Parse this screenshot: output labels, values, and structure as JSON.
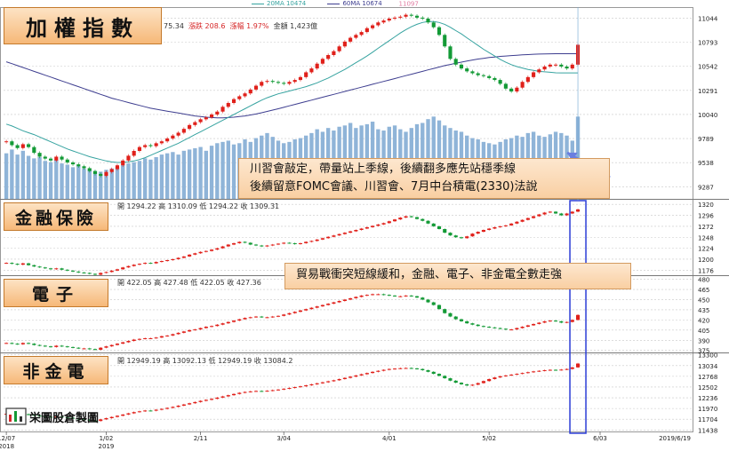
{
  "legend": {
    "ma20": {
      "label": "20MA 10474",
      "color": "#36a3a0"
    },
    "ma60": {
      "label": "60MA 10674",
      "color": "#3d3d8f"
    }
  },
  "panels": [
    {
      "id": "taiex",
      "title": "加權指數",
      "stats_parts": [
        "75.34",
        "漲跌 208.6",
        "漲幅 1.97%",
        "金額 1,423億"
      ]
    },
    {
      "id": "finance",
      "title": "金融保險",
      "stats_parts": [
        "開 1294.22",
        "高 1310.09",
        "低 1294.22",
        "收 1309.31"
      ]
    },
    {
      "id": "electronics",
      "title": "電子",
      "stats_parts": [
        "開 422.05",
        "高 427.48",
        "低 422.05",
        "收 427.36"
      ]
    },
    {
      "id": "nonfin_elec",
      "title": "非金電",
      "stats_parts": [
        "開 12949.19",
        "高 13092.13",
        "低 12949.19",
        "收 13084.2"
      ]
    }
  ],
  "notes": {
    "note1": [
      "川習會敲定，帶量站上季線，後續翻多應先站穩季線",
      "後續留意FOMC會議、川習會、7月中台積電(2330)法說"
    ],
    "note2": [
      "貿易戰衝突短線緩和，金融、電子、非金電全數走強"
    ]
  },
  "logo_text": "栄圖股倉製圖",
  "peak_label": "11097",
  "colors": {
    "up": "#e0201a",
    "down": "#139a36",
    "volume": "#8fb4d8",
    "highlight": "#2b3dd6",
    "arrow": "#6a7fe0",
    "grid": "#c8c8c8"
  },
  "chart_data": [
    {
      "type": "candlestick",
      "id": "taiex",
      "title": "加權指數",
      "yticks": [
        11044,
        10793,
        10542,
        10291,
        10040,
        9789,
        9538,
        9287
      ],
      "ylim": [
        9160,
        11160
      ],
      "close": [
        9760,
        9720,
        9690,
        9730,
        9700,
        9640,
        9600,
        9580,
        9560,
        9600,
        9570,
        9540,
        9520,
        9500,
        9480,
        9450,
        9420,
        9400,
        9440,
        9470,
        9510,
        9560,
        9610,
        9660,
        9700,
        9720,
        9710,
        9740,
        9760,
        9790,
        9820,
        9850,
        9890,
        9930,
        9960,
        9990,
        10010,
        10040,
        10070,
        10120,
        10160,
        10200,
        10230,
        10260,
        10300,
        10340,
        10380,
        10390,
        10380,
        10370,
        10360,
        10380,
        10400,
        10430,
        10480,
        10520,
        10570,
        10620,
        10660,
        10700,
        10750,
        10800,
        10840,
        10870,
        10900,
        10940,
        10970,
        11000,
        11020,
        11040,
        11050,
        11060,
        11080,
        11070,
        11050,
        11040,
        11000,
        10950,
        10870,
        10750,
        10620,
        10560,
        10520,
        10490,
        10470,
        10450,
        10440,
        10420,
        10400,
        10360,
        10310,
        10280,
        10320,
        10380,
        10430,
        10480,
        10510,
        10540,
        10560,
        10560,
        10540,
        10520,
        10560,
        10767
      ],
      "volume_ylim": [
        0,
        1600
      ],
      "volume": [
        720,
        780,
        700,
        760,
        680,
        640,
        660,
        600,
        580,
        620,
        560,
        540,
        500,
        520,
        480,
        470,
        440,
        430,
        460,
        480,
        500,
        540,
        560,
        580,
        600,
        640,
        620,
        660,
        700,
        720,
        740,
        700,
        760,
        780,
        800,
        820,
        760,
        840,
        880,
        900,
        920,
        860,
        880,
        940,
        900,
        960,
        1000,
        1040,
        980,
        920,
        880,
        900,
        940,
        960,
        1000,
        1040,
        1100,
        1060,
        1120,
        1080,
        1140,
        1160,
        1200,
        1120,
        1160,
        1180,
        1220,
        1100,
        1080,
        1140,
        1160,
        1100,
        1060,
        1120,
        1180,
        1200,
        1260,
        1300,
        1240,
        1160,
        1120,
        1080,
        1060,
        1000,
        960,
        940,
        900,
        880,
        860,
        900,
        940,
        960,
        1000,
        980,
        1040,
        1060,
        1000,
        980,
        1020,
        1060,
        1040,
        1000,
        920,
        1300
      ],
      "ma20": [
        9940,
        9920,
        9895,
        9870,
        9850,
        9830,
        9805,
        9780,
        9755,
        9730,
        9705,
        9680,
        9660,
        9640,
        9620,
        9600,
        9585,
        9570,
        9555,
        9545,
        9540,
        9540,
        9545,
        9555,
        9570,
        9590,
        9615,
        9640,
        9665,
        9690,
        9715,
        9740,
        9770,
        9800,
        9830,
        9860,
        9890,
        9920,
        9950,
        9980,
        10010,
        10040,
        10070,
        10100,
        10130,
        10160,
        10190,
        10215,
        10235,
        10255,
        10270,
        10285,
        10300,
        10315,
        10330,
        10350,
        10370,
        10395,
        10420,
        10450,
        10480,
        10510,
        10545,
        10580,
        10615,
        10650,
        10690,
        10730,
        10770,
        10810,
        10850,
        10890,
        10925,
        10955,
        10980,
        11000,
        11010,
        11010,
        11000,
        10980,
        10950,
        10915,
        10880,
        10840,
        10800,
        10760,
        10720,
        10685,
        10650,
        10615,
        10585,
        10560,
        10540,
        10525,
        10510,
        10500,
        10490,
        10485,
        10480,
        10475,
        10474,
        10474,
        10474,
        10474
      ],
      "ma60": [
        10590,
        10570,
        10550,
        10530,
        10510,
        10490,
        10470,
        10450,
        10430,
        10410,
        10390,
        10370,
        10350,
        10330,
        10310,
        10290,
        10270,
        10250,
        10230,
        10210,
        10195,
        10180,
        10165,
        10150,
        10135,
        10120,
        10105,
        10095,
        10085,
        10075,
        10065,
        10055,
        10045,
        10035,
        10025,
        10018,
        10012,
        10008,
        10005,
        10005,
        10008,
        10012,
        10018,
        10025,
        10035,
        10045,
        10058,
        10072,
        10086,
        10100,
        10115,
        10130,
        10145,
        10160,
        10175,
        10190,
        10205,
        10220,
        10235,
        10250,
        10265,
        10280,
        10295,
        10310,
        10325,
        10340,
        10355,
        10370,
        10385,
        10400,
        10415,
        10430,
        10445,
        10460,
        10475,
        10490,
        10505,
        10520,
        10535,
        10550,
        10562,
        10574,
        10586,
        10598,
        10608,
        10618,
        10626,
        10634,
        10640,
        10646,
        10650,
        10654,
        10658,
        10662,
        10665,
        10668,
        10670,
        10672,
        10673,
        10674,
        10674,
        10674,
        10674,
        10674
      ]
    },
    {
      "type": "candlestick",
      "id": "finance",
      "title": "金融保險",
      "yticks": [
        1320,
        1296,
        1272,
        1248,
        1224,
        1200,
        1176
      ],
      "ylim": [
        1165,
        1332
      ],
      "close": [
        1192,
        1190,
        1188,
        1191,
        1187,
        1184,
        1182,
        1180,
        1178,
        1180,
        1177,
        1175,
        1173,
        1171,
        1170,
        1168,
        1166,
        1170,
        1172,
        1175,
        1178,
        1182,
        1185,
        1188,
        1190,
        1192,
        1191,
        1194,
        1196,
        1198,
        1200,
        1203,
        1206,
        1210,
        1213,
        1216,
        1218,
        1221,
        1224,
        1228,
        1232,
        1235,
        1238,
        1236,
        1232,
        1230,
        1228,
        1230,
        1232,
        1234,
        1236,
        1235,
        1233,
        1235,
        1238,
        1240,
        1243,
        1246,
        1249,
        1252,
        1255,
        1258,
        1261,
        1264,
        1267,
        1270,
        1273,
        1276,
        1279,
        1283,
        1287,
        1291,
        1294,
        1292,
        1288,
        1284,
        1278,
        1272,
        1266,
        1258,
        1252,
        1248,
        1246,
        1250,
        1256,
        1260,
        1264,
        1267,
        1270,
        1272,
        1274,
        1278,
        1282,
        1286,
        1290,
        1294,
        1298,
        1302,
        1304,
        1300,
        1296,
        1300,
        1304,
        1309
      ],
      "volume": []
    },
    {
      "type": "candlestick",
      "id": "electronics",
      "title": "電子",
      "yticks": [
        480,
        465,
        450,
        435,
        420,
        405,
        390,
        375
      ],
      "ylim": [
        372,
        486
      ],
      "close": [
        386,
        385,
        384,
        386,
        385,
        383,
        382,
        381,
        380,
        382,
        381,
        380,
        379,
        378,
        378,
        377,
        376,
        379,
        381,
        383,
        385,
        387,
        389,
        391,
        392,
        393,
        393,
        394,
        396,
        397,
        399,
        401,
        403,
        405,
        406,
        408,
        410,
        411,
        413,
        415,
        417,
        419,
        421,
        423,
        424,
        425,
        424,
        424,
        425,
        426,
        428,
        430,
        432,
        434,
        436,
        438,
        440,
        442,
        444,
        446,
        448,
        450,
        452,
        454,
        456,
        457,
        458,
        458,
        457,
        456,
        455,
        455,
        456,
        455,
        453,
        450,
        446,
        442,
        436,
        430,
        425,
        421,
        418,
        415,
        413,
        411,
        410,
        409,
        408,
        407,
        406,
        406,
        408,
        410,
        412,
        414,
        416,
        418,
        419,
        418,
        416,
        417,
        420,
        427.36
      ],
      "volume": []
    },
    {
      "type": "candlestick",
      "id": "nonfin_elec",
      "title": "非金電",
      "yticks": [
        13300,
        13034,
        12768,
        12502,
        12236,
        11970,
        11704,
        11438
      ],
      "ylim": [
        11400,
        13360
      ],
      "close": [
        11840,
        11825,
        11810,
        11830,
        11815,
        11795,
        11780,
        11765,
        11750,
        11770,
        11755,
        11740,
        11720,
        11700,
        11690,
        11675,
        11660,
        11700,
        11730,
        11760,
        11790,
        11820,
        11850,
        11880,
        11900,
        11920,
        11915,
        11940,
        11960,
        11985,
        12010,
        12040,
        12070,
        12100,
        12130,
        12160,
        12185,
        12210,
        12240,
        12270,
        12300,
        12330,
        12360,
        12380,
        12395,
        12405,
        12400,
        12410,
        12425,
        12440,
        12460,
        12480,
        12500,
        12520,
        12545,
        12570,
        12595,
        12620,
        12645,
        12670,
        12700,
        12730,
        12760,
        12790,
        12820,
        12850,
        12880,
        12905,
        12930,
        12950,
        12960,
        12970,
        12975,
        12965,
        12950,
        12920,
        12880,
        12830,
        12780,
        12720,
        12660,
        12610,
        12570,
        12540,
        12560,
        12600,
        12650,
        12700,
        12740,
        12770,
        12790,
        12810,
        12830,
        12850,
        12870,
        12890,
        12905,
        12920,
        12930,
        12925,
        12935,
        12950,
        12990,
        13084.2
      ],
      "volume": []
    }
  ],
  "x_axis": {
    "ticks": [
      {
        "index": 0,
        "label": "12/07",
        "sub": "2018"
      },
      {
        "index": 18,
        "label": "1/02",
        "sub": "2019"
      },
      {
        "index": 35,
        "label": "2/11",
        "sub": ""
      },
      {
        "index": 50,
        "label": "3/04",
        "sub": ""
      },
      {
        "index": 69,
        "label": "4/01",
        "sub": ""
      },
      {
        "index": 87,
        "label": "5/02",
        "sub": ""
      },
      {
        "index": 107,
        "label": "6/03",
        "sub": ""
      }
    ],
    "last_label": "2019/6/19",
    "total_days": 124
  }
}
